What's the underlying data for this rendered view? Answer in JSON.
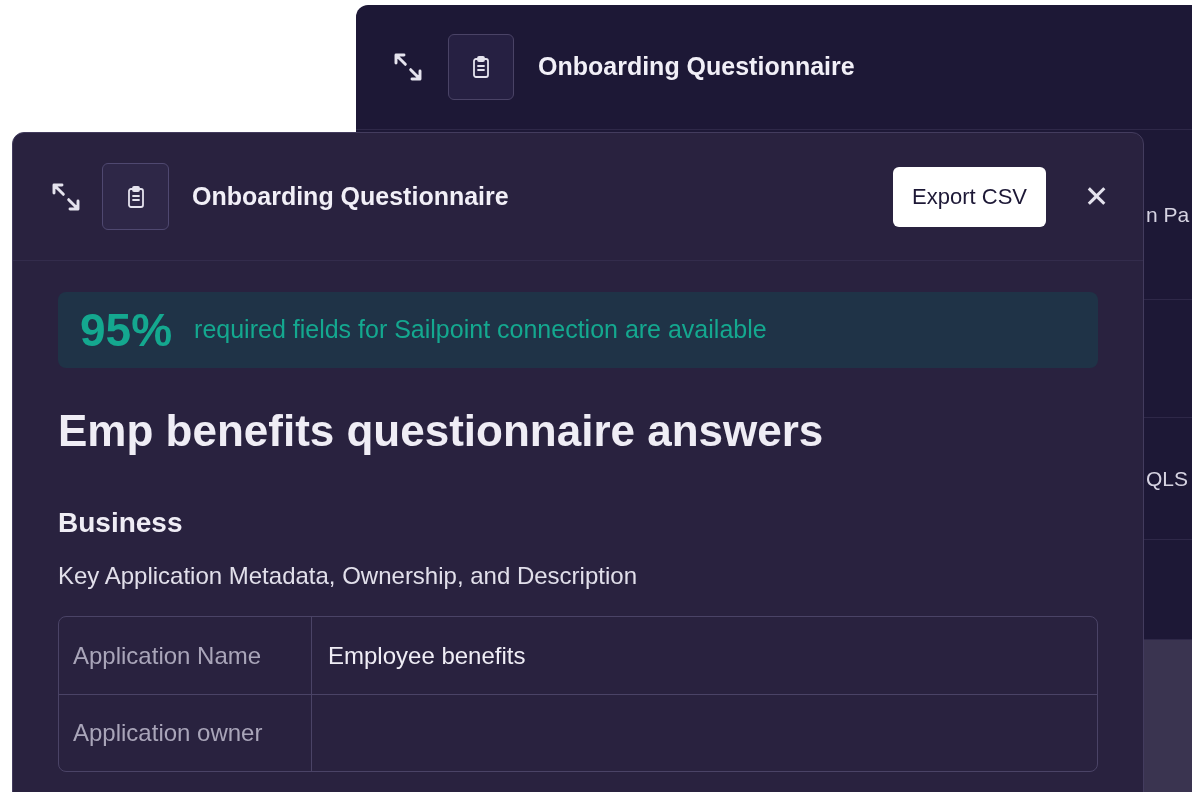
{
  "back_window": {
    "title": "Onboarding Questionnaire",
    "fragments": [
      "n Pa",
      "QLS"
    ]
  },
  "front_window": {
    "title": "Onboarding Questionnaire",
    "export_button": "Export CSV",
    "close": "✕",
    "banner": {
      "percent": "95%",
      "text": "required fields for Sailpoint connection are available"
    },
    "heading": "Emp benefits questionnaire answers",
    "section": {
      "title": "Business",
      "description": "Key Application Metadata, Ownership, and Description"
    },
    "table": {
      "rows": [
        {
          "label": "Application Name",
          "value": "Employee benefits"
        },
        {
          "label": "Application owner"
        }
      ]
    }
  }
}
